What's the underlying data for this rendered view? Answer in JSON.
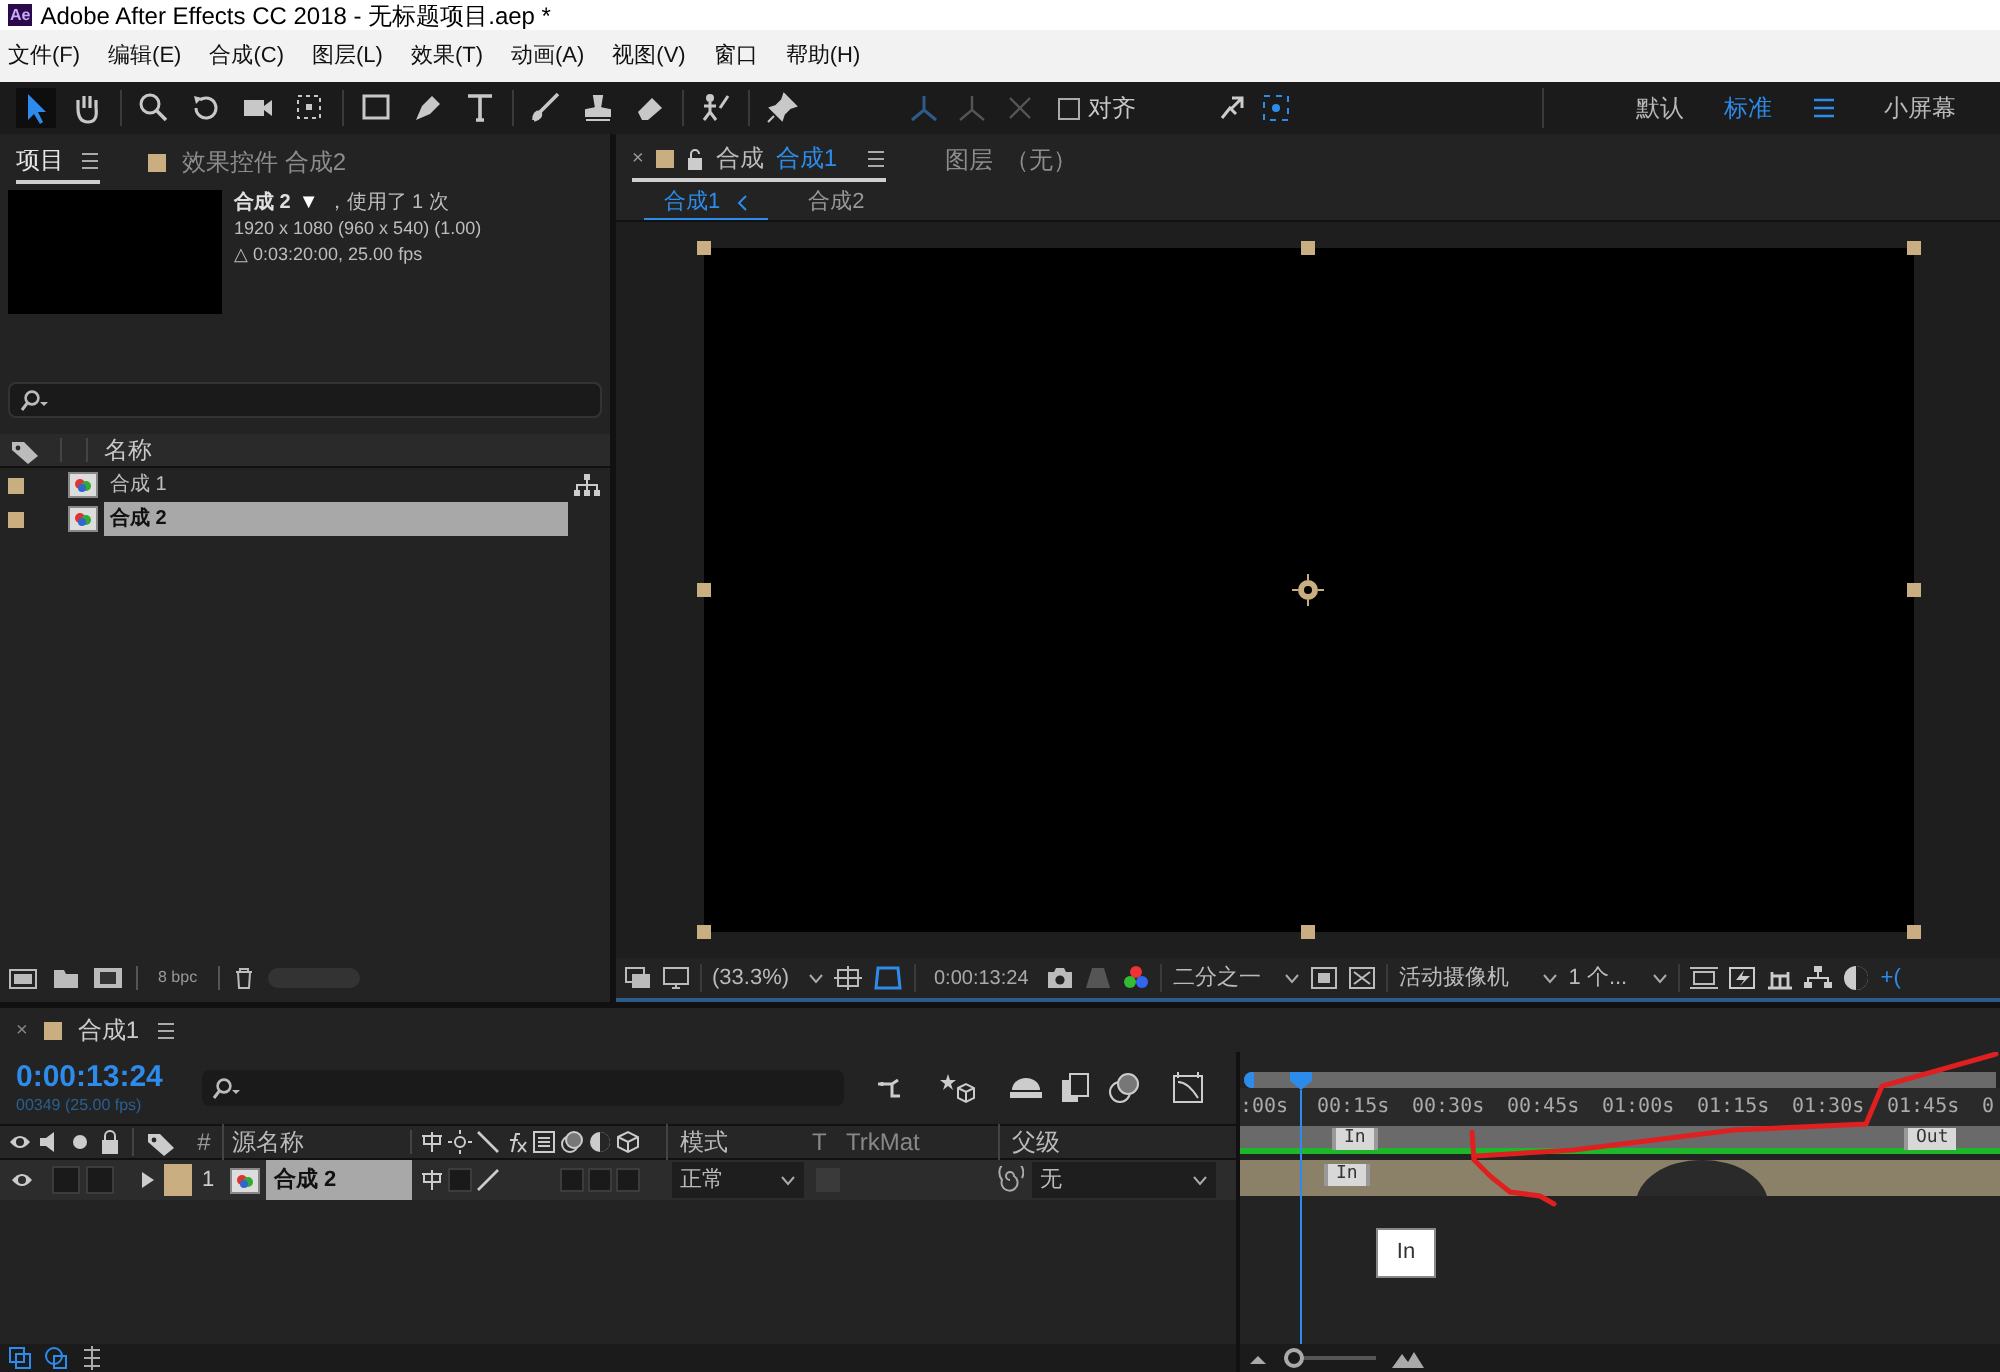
{
  "window": {
    "logo": "Ae",
    "title": "Adobe After Effects CC 2018 - 无标题项目.aep *"
  },
  "menu": [
    "文件(F)",
    "编辑(E)",
    "合成(C)",
    "图层(L)",
    "效果(T)",
    "动画(A)",
    "视图(V)",
    "窗口",
    "帮助(H)"
  ],
  "toolbar": {
    "tools": [
      {
        "selected": true
      },
      {
        "selected": false
      },
      {
        "selected": false
      },
      {
        "selected": false
      },
      {
        "selected": false
      },
      {
        "selected": false
      },
      {
        "selected": false
      },
      {
        "selected": false
      },
      {
        "selected": false
      },
      {
        "selected": false
      },
      {
        "selected": false
      },
      {
        "selected": false
      },
      {
        "selected": false
      },
      {
        "selected": false
      }
    ],
    "snap": {
      "label": "对齐",
      "checked": false
    },
    "workspaces": [
      {
        "label": "默认",
        "selected": false
      },
      {
        "label": "标准",
        "selected": true
      },
      {
        "label": "小屏幕",
        "selected": false
      }
    ]
  },
  "project_panel": {
    "tabs": [
      {
        "label": "项目",
        "selected": true
      },
      {
        "label": "效果控件 合成2",
        "selected": false
      }
    ],
    "info": {
      "name": "合成 2",
      "caret": "▼",
      "usage": "，使用了 1 次",
      "size": "1920 x 1080 (960 x 540) (1.00)",
      "duration": "△ 0:03:20:00, 25.00 fps"
    },
    "column": "名称",
    "items": [
      {
        "name": "合成 1",
        "selected": false,
        "flowchart": true
      },
      {
        "name": "合成 2",
        "selected": true,
        "flowchart": false
      }
    ],
    "bpc": "8 bpc"
  },
  "viewer": {
    "tabs": [
      {
        "close": "×",
        "prefix": "合成",
        "label": "合成1",
        "selected": true
      },
      {
        "prefix": "图层",
        "label": "（无）",
        "selected": false
      }
    ],
    "breadcrumbs": [
      {
        "label": "合成1",
        "selected": true
      },
      {
        "label": "合成2",
        "selected": false
      }
    ],
    "zoom": "(33.3%)",
    "timecode": "0:00:13:24",
    "resolution": "二分之一",
    "camera": "活动摄像机",
    "views": "1 个...",
    "exposure": "+("
  },
  "timeline": {
    "close": "×",
    "tab": "合成1",
    "zoom_slider": {
      "level": 0
    },
    "timecode": "0:00:13:24",
    "frames": "00349 (25.00 fps)",
    "columns": {
      "number": "#",
      "source": "源名称",
      "mode": "模式",
      "t": "T",
      "trkmat": "TrkMat",
      "parent": "父级"
    },
    "layers": [
      {
        "number": "1",
        "name": "合成 2",
        "expanded": false,
        "visible": true,
        "mode": "正常",
        "parent": "无"
      }
    ],
    "ruler": [
      ":00s",
      "00:15s",
      "00:30s",
      "00:45s",
      "01:00s",
      "01:15s",
      "01:30s",
      "01:45s",
      "0"
    ],
    "in_label": "In",
    "out_label": "Out",
    "bar_label": "In",
    "tooltip": "In"
  }
}
